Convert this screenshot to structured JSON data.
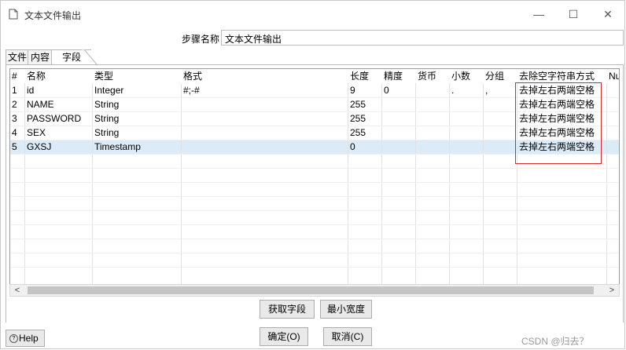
{
  "window": {
    "title": "文本文件输出",
    "controls": {
      "minimize": "—",
      "maximize": "☐",
      "close": "✕"
    }
  },
  "step": {
    "label": "步骤名称",
    "value": "文本文件输出"
  },
  "tabs": [
    {
      "label": "文件"
    },
    {
      "label": "内容"
    },
    {
      "label": "字段"
    }
  ],
  "grid": {
    "headers": [
      "#",
      "名称",
      "类型",
      "格式",
      "长度",
      "精度",
      "货币",
      "小数",
      "分组",
      "去除空字符串方式",
      "Nu"
    ],
    "rows": [
      {
        "num": "1",
        "name": "id",
        "type": "Integer",
        "format": "#;-#",
        "length": "9",
        "precision": "0",
        "currency": "",
        "decimal": ".",
        "group": ",",
        "trim": "去掉左右两端空格"
      },
      {
        "num": "2",
        "name": "NAME",
        "type": "String",
        "format": "",
        "length": "255",
        "precision": "",
        "currency": "",
        "decimal": "",
        "group": "",
        "trim": "去掉左右两端空格"
      },
      {
        "num": "3",
        "name": "PASSWORD",
        "type": "String",
        "format": "",
        "length": "255",
        "precision": "",
        "currency": "",
        "decimal": "",
        "group": "",
        "trim": "去掉左右两端空格"
      },
      {
        "num": "4",
        "name": "SEX",
        "type": "String",
        "format": "",
        "length": "255",
        "precision": "",
        "currency": "",
        "decimal": "",
        "group": "",
        "trim": "去掉左右两端空格"
      },
      {
        "num": "5",
        "name": "GXSJ",
        "type": "Timestamp",
        "format": "",
        "length": "0",
        "precision": "",
        "currency": "",
        "decimal": "",
        "group": "",
        "trim": "去掉左右两端空格"
      }
    ],
    "selected_row": 5
  },
  "scrollbar": {
    "left_arrow": "<",
    "right_arrow": ">"
  },
  "buttons": {
    "get_fields": "获取字段",
    "min_width": "最小宽度",
    "ok": "确定(O)",
    "cancel": "取消(C)",
    "help": "Help"
  },
  "watermark": "CSDN @归去？",
  "colors": {
    "highlight_border": "#d62a2a",
    "selected_row": "#dcebf8"
  }
}
